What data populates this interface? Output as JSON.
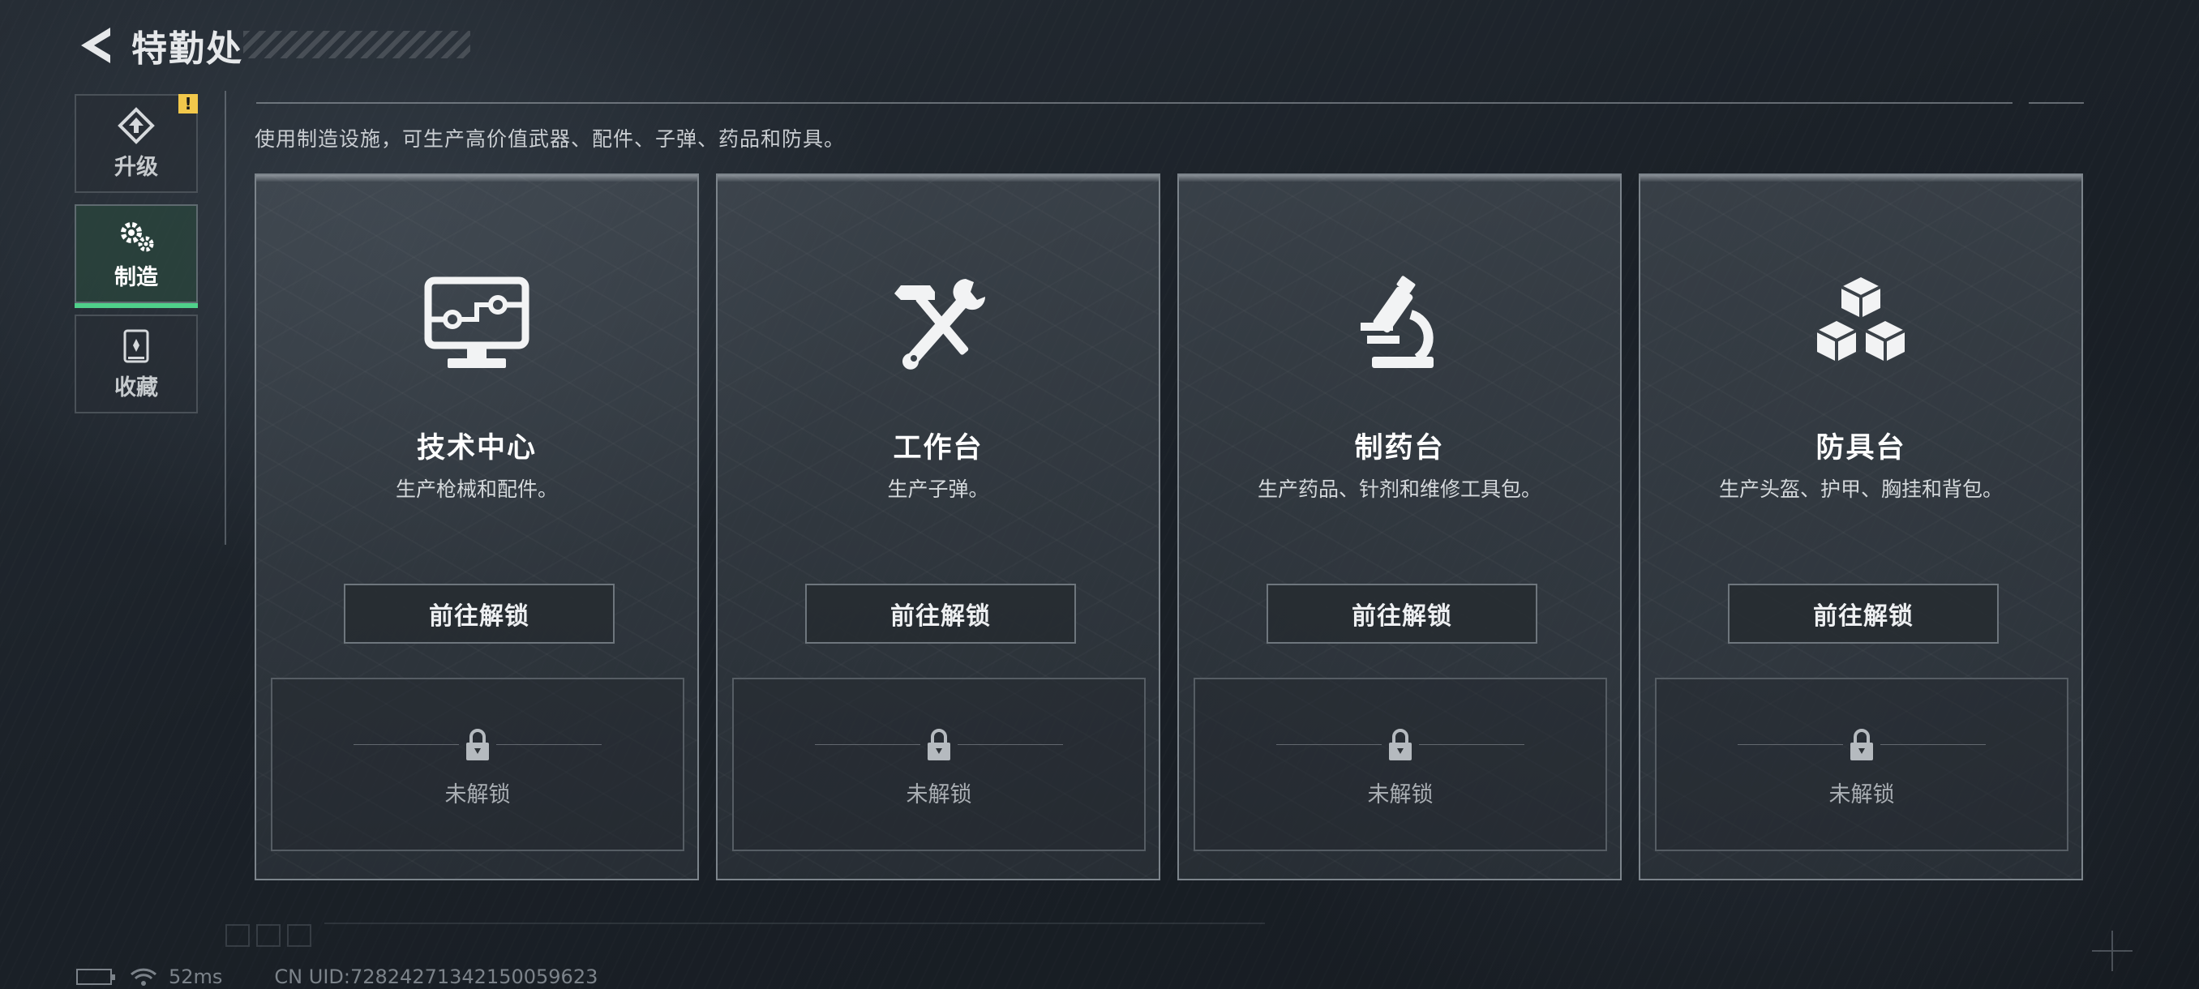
{
  "header": {
    "title": "特勤处"
  },
  "sidebar": {
    "items": [
      {
        "label": "升级",
        "icon": "upgrade-icon",
        "badge": "!"
      },
      {
        "label": "制造",
        "icon": "gear-icon"
      },
      {
        "label": "收藏",
        "icon": "collection-icon"
      }
    ]
  },
  "description": "使用制造设施，可生产高价值武器、配件、子弹、药品和防具。",
  "cards": [
    {
      "title": "技术中心",
      "subtitle": "生产枪械和配件。",
      "button": "前往解锁",
      "locked_label": "未解锁",
      "icon": "computer-icon"
    },
    {
      "title": "工作台",
      "subtitle": "生产子弹。",
      "button": "前往解锁",
      "locked_label": "未解锁",
      "icon": "hammer-wrench-icon"
    },
    {
      "title": "制药台",
      "subtitle": "生产药品、针剂和维修工具包。",
      "button": "前往解锁",
      "locked_label": "未解锁",
      "icon": "microscope-icon"
    },
    {
      "title": "防具台",
      "subtitle": "生产头盔、护甲、胸挂和背包。",
      "button": "前往解锁",
      "locked_label": "未解锁",
      "icon": "cubes-icon"
    }
  ],
  "status": {
    "ping": "52ms",
    "uid": "CN UID:72824271342150059623"
  },
  "colors": {
    "accent": "#4fd08a",
    "badge": "#f2c84b"
  }
}
